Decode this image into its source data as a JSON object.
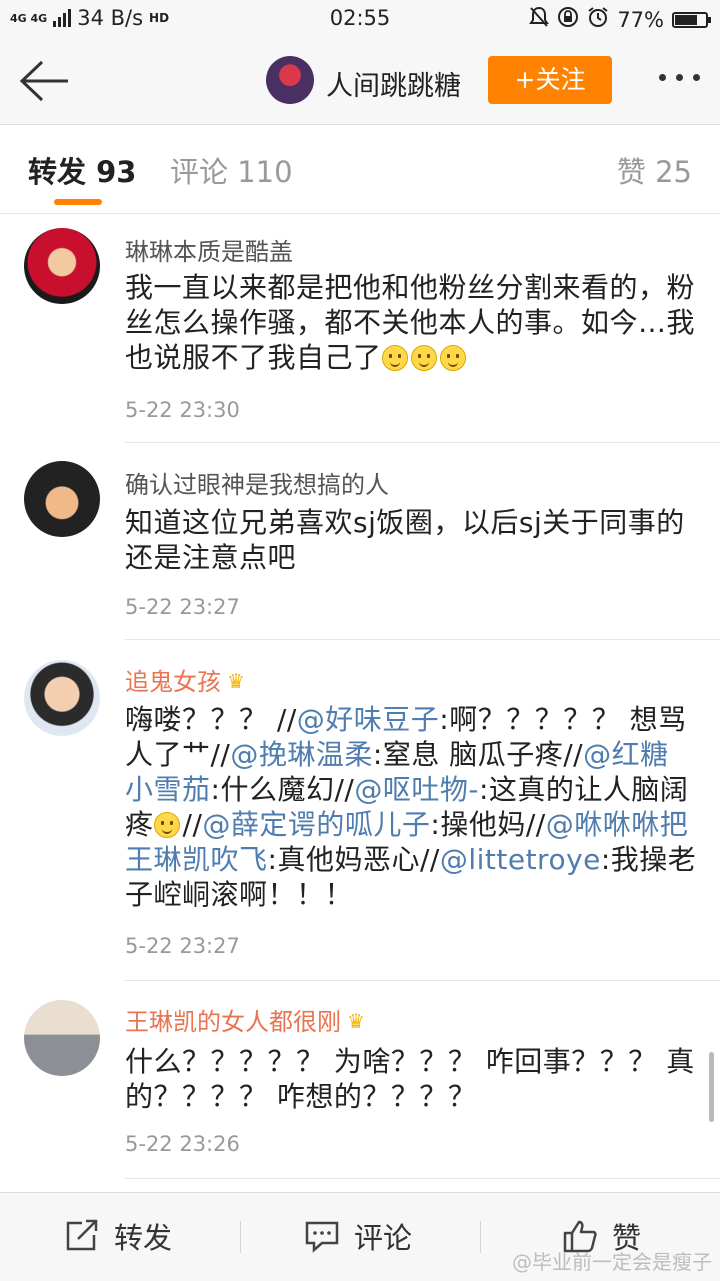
{
  "status_bar": {
    "network": "4G 4G",
    "speed": "34 B/s",
    "hd": "HD",
    "time": "02:55",
    "battery": "77%",
    "battery_level": 0.77
  },
  "header": {
    "username": "人间跳跳糖",
    "follow_label": "+关注"
  },
  "tabs": {
    "repost": "转发 93",
    "comment": "评论 110",
    "like": "赞 25",
    "active": "repost"
  },
  "comments": [
    {
      "name": "琳琳本质是酷盖",
      "vip": false,
      "segments": [
        {
          "t": "我一直以来都是把他和他粉丝分割来看的，粉丝怎么操作骚，都不关他本人的事。如今…我也说服不了我自己了"
        }
      ],
      "emoji_count": 3,
      "time": "5-22 23:30"
    },
    {
      "name": "确认过眼神是我想搞的人",
      "vip": false,
      "segments": [
        {
          "t": "知道这位兄弟喜欢sj饭圈，以后sj关于同事的还是注意点吧"
        }
      ],
      "emoji_count": 0,
      "time": "5-22 23:27"
    },
    {
      "name": "追鬼女孩",
      "vip": true,
      "segments": [
        {
          "t": "嗨喽？？？ //"
        },
        {
          "t": "@好味豆子",
          "at": true
        },
        {
          "t": ":啊？？？？？ 想骂人了艹//"
        },
        {
          "t": "@挽琳温柔",
          "at": true
        },
        {
          "t": ":窒息 脑瓜子疼//"
        },
        {
          "t": "@红糖小雪茄",
          "at": true
        },
        {
          "t": ":什么魔幻//"
        },
        {
          "t": "@呕吐物-",
          "at": true
        },
        {
          "t": ":这真的让人脑阔疼"
        },
        {
          "t": "",
          "emoji": true
        },
        {
          "t": "//"
        },
        {
          "t": "@薛定谔的呱儿子",
          "at": true
        },
        {
          "t": ":操他妈//"
        },
        {
          "t": "@咻咻咻把王琳凯吹飞",
          "at": true
        },
        {
          "t": ":真他妈恶心//"
        },
        {
          "t": "@littetroye",
          "at": true
        },
        {
          "t": ":我操老子崆峒滚啊！！！"
        }
      ],
      "emoji_count": 0,
      "time": "5-22 23:27"
    },
    {
      "name": "王琳凯的女人都很刚",
      "vip": true,
      "segments": [
        {
          "t": "什么？？？？？ 为啥？？？ 咋回事？？？ 真的？？？？ 咋想的？？？？"
        }
      ],
      "emoji_count": 0,
      "time": "5-22 23:26"
    }
  ],
  "bottom_bar": {
    "repost": "转发",
    "comment": "评论",
    "like": "赞"
  },
  "watermark": "@毕业前一定会是瘦子",
  "colors": {
    "accent": "#ff8200",
    "link": "#507daf",
    "vip_name": "#eb7350"
  }
}
